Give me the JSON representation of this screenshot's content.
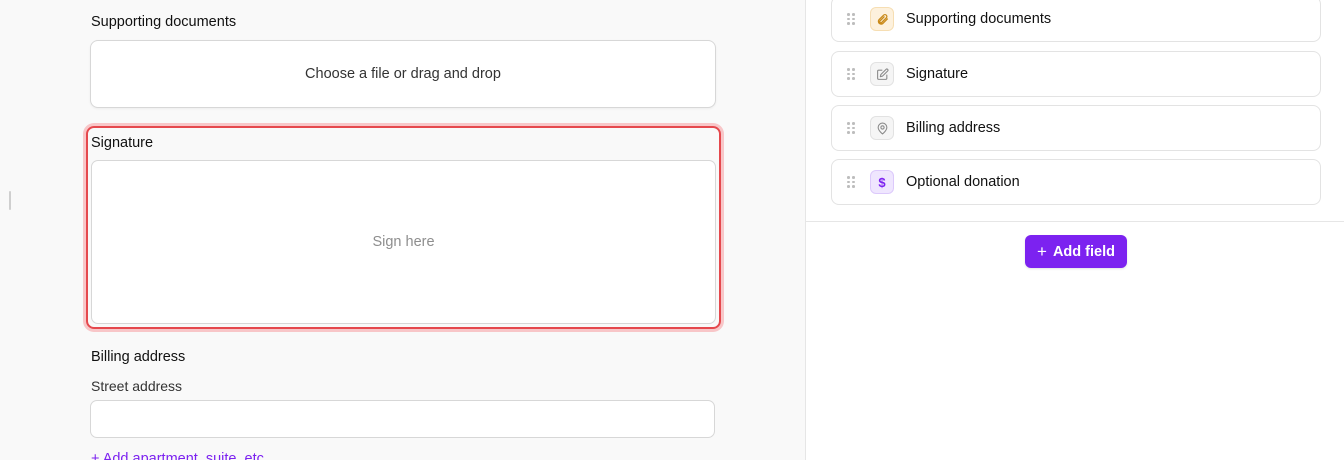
{
  "canvas": {
    "supporting_documents": {
      "label": "Supporting documents",
      "upload_text": "Choose a file or drag and drop"
    },
    "signature": {
      "label": "Signature",
      "placeholder": "Sign here"
    },
    "billing_address": {
      "label": "Billing address",
      "street_label": "Street address",
      "street_value": "",
      "add_apartment_link": "+ Add apartment, suite, etc."
    }
  },
  "panel": {
    "fields": [
      {
        "label": "Supporting documents",
        "icon": "paperclip-icon"
      },
      {
        "label": "Signature",
        "icon": "pencil-square-icon"
      },
      {
        "label": "Billing address",
        "icon": "map-pin-icon"
      },
      {
        "label": "Optional donation",
        "icon": "dollar-icon"
      }
    ],
    "add_field_button": "Add field",
    "add_field_plus": "+"
  },
  "colors": {
    "accent": "#7c22f0",
    "selection_border": "#e5484d",
    "selection_glow": "#f8c6c8"
  }
}
